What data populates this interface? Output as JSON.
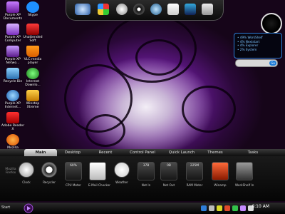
{
  "desktop": {
    "icons": [
      {
        "label": "Purple XP Documents",
        "icon": "folder-icon"
      },
      {
        "label": "Skype",
        "icon": "skype-icon"
      },
      {
        "label": "Purple XP Computer",
        "icon": "computer-icon"
      },
      {
        "label": "Unattended Soft",
        "icon": "unattended-icon"
      },
      {
        "label": "Purple XP Netwo...",
        "icon": "network-icon"
      },
      {
        "label": "VLC media player",
        "icon": "vlc-icon"
      },
      {
        "label": "Recycle Bin",
        "icon": "recycle-bin-icon"
      },
      {
        "label": "Internet Downlo...",
        "icon": "internet-download-icon"
      },
      {
        "label": "Purple XP Internet...",
        "icon": "internet-explorer-icon"
      },
      {
        "label": "Winstep Xtreme",
        "icon": "winstep-icon"
      },
      {
        "label": "Adobe Reader X",
        "icon": "adobe-reader-icon"
      },
      {
        "label": "Mozilla",
        "icon": "firefox-icon"
      }
    ]
  },
  "widget": {
    "stats": [
      "• 49% WorkShelf",
      "• 4% Nextstart",
      "• 4% Explorer",
      "• 2% System"
    ],
    "search_button": "Go"
  },
  "shelf": {
    "tabs": [
      "Main",
      "Desktop",
      "Recent",
      "Control Panel",
      "Quick Launch",
      "Themes",
      "Tasks"
    ],
    "active_tab": "Main",
    "tiles": [
      {
        "label": "Clock",
        "value": ""
      },
      {
        "label": "Recycler",
        "value": ""
      },
      {
        "label": "CPU Meter",
        "value": "60%"
      },
      {
        "label": "E-Mail Checker",
        "value": ""
      },
      {
        "label": "Weather",
        "value": ""
      },
      {
        "label": "Net In",
        "value": "37B"
      },
      {
        "label": "Net Out",
        "value": "0B"
      },
      {
        "label": "RAM Meter",
        "value": "225M"
      },
      {
        "label": "Winamp",
        "value": ""
      },
      {
        "label": "WorkShelf In",
        "value": ""
      }
    ],
    "side_label": "Mozilla Firefox"
  },
  "taskbar": {
    "time": "6:10 AM",
    "start_label": "Start"
  },
  "colors": {
    "accent": "#8e2fc0",
    "panel_border": "#2e7dd8",
    "panel_text": "#7cc4ff"
  }
}
